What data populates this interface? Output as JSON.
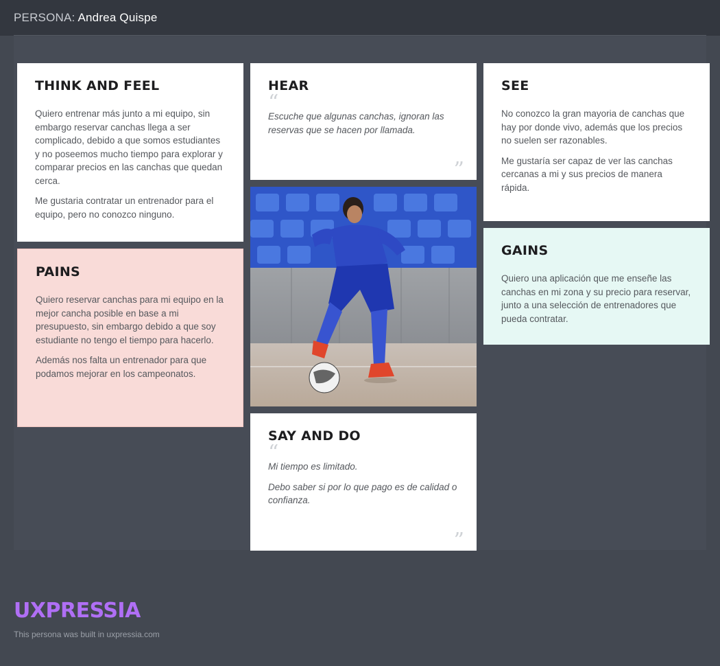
{
  "header": {
    "label": "PERSONA:",
    "name": "Andrea Quispe"
  },
  "think_and_feel": {
    "title": "THINK AND FEEL",
    "paragraphs": [
      "Quiero entrenar más junto a mi equipo, sin embargo reservar canchas llega a ser complicado, debido a que somos estudiantes y no poseemos mucho tiempo para explorar y comparar precios en las canchas que quedan cerca.",
      "Me gustaria contratar un entrenador para el equipo, pero no conozco ninguno."
    ]
  },
  "pains": {
    "title": "PAINS",
    "paragraphs": [
      "Quiero reservar canchas para mi equipo en la mejor cancha posible en base a mi presupuesto, sin embargo debido a que soy estudiante no tengo el tiempo para hacerlo.",
      "Además nos falta un entrenador para que podamos mejorar en los campeonatos."
    ]
  },
  "hear": {
    "title": "HEAR",
    "paragraphs": [
      "Escuche que algunas canchas, ignoran las reservas que se hacen por llamada."
    ]
  },
  "say_and_do": {
    "title": "SAY AND DO",
    "paragraphs": [
      "Mi tiempo es limitado.",
      "Debo saber si por lo que pago es de calidad o confianza."
    ]
  },
  "see": {
    "title": "SEE",
    "paragraphs": [
      "No conozco la gran mayoria de canchas que hay por donde vivo, además que los precios no suelen ser razonables.",
      "Me gustaría ser capaz de ver las canchas cercanas a mi y sus precios de manera rápida."
    ]
  },
  "gains": {
    "title": "GAINS",
    "paragraphs": [
      "Quiero una aplicación que me enseñe las canchas en mi zona y su precio para reservar, junto a una selección de entrenadores que pueda contratar."
    ]
  },
  "quote_marks": {
    "open": "“",
    "close": "”"
  },
  "footer": {
    "logo": "UXPRESSIA",
    "note": "This persona was built in uxpressia.com"
  },
  "colors": {
    "background": "#434851",
    "pains_bg": "#f9dbd8",
    "gains_bg": "#e6f8f4",
    "logo": "#b06ff5"
  }
}
